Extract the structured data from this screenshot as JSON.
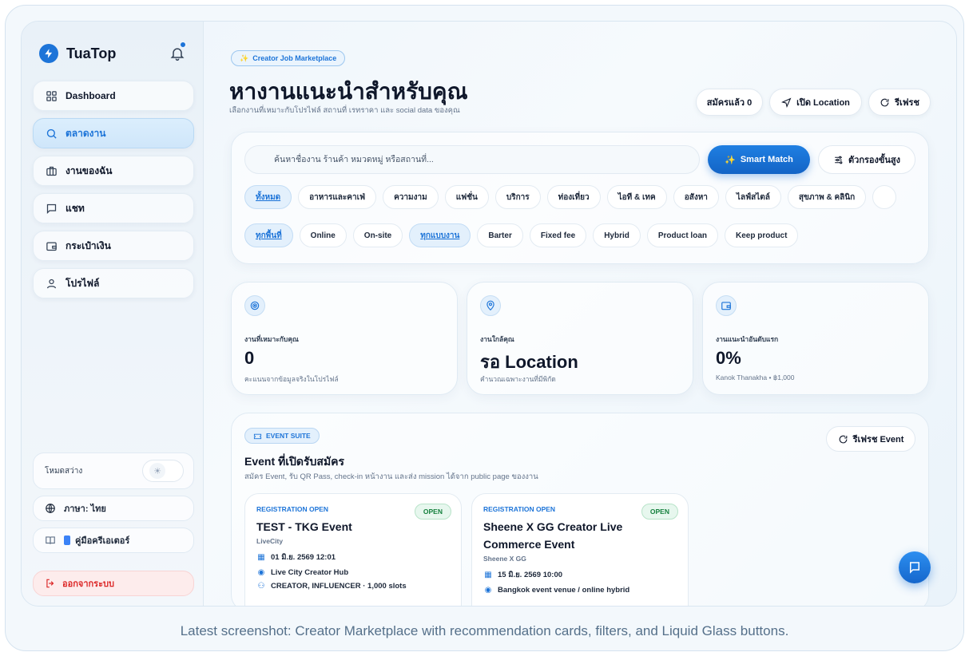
{
  "app": {
    "name": "TuaTop"
  },
  "sidebar": {
    "items": [
      {
        "label": "Dashboard",
        "icon": "grid-icon"
      },
      {
        "label": "ตลาดงาน",
        "icon": "search-icon"
      },
      {
        "label": "งานของฉัน",
        "icon": "briefcase-icon"
      },
      {
        "label": "แชท",
        "icon": "chat-icon"
      },
      {
        "label": "กระเป๋าเงิน",
        "icon": "wallet-icon"
      },
      {
        "label": "โปรไฟล์",
        "icon": "user-icon"
      }
    ],
    "theme_label": "โหมดสว่าง",
    "language_label": "ภาษา: ไทย",
    "guide_label": "คู่มือครีเอเตอร์",
    "logout_label": "ออกจากระบบ"
  },
  "header": {
    "tag": "Creator Job Marketplace",
    "title": "หางานแนะนำสำหรับคุณ",
    "subtitle": "เลือกงานที่เหมาะกับโปรไฟล์ สถานที่ เรทราคา และ social data ของคุณ",
    "applied_label": "สมัครแล้ว 0",
    "location_label": "เปิด Location",
    "refresh_label": "รีเฟรช"
  },
  "search": {
    "placeholder": "ค้นหาชื่องาน ร้านค้า หมวดหมู่ หรือสถานที่...",
    "smart_match_label": "Smart Match",
    "advanced_label": "ตัวกรองขั้นสูง"
  },
  "categories": [
    "ทั้งหมด",
    "อาหารและคาเฟ่",
    "ความงาม",
    "แฟชั่น",
    "บริการ",
    "ท่องเที่ยว",
    "ไอที & เทค",
    "อสังหา",
    "ไลฟ์สไตล์",
    "สุขภาพ & คลินิก",
    ""
  ],
  "filters": [
    "ทุกพื้นที่",
    "Online",
    "On-site",
    "ทุกแบบงาน",
    "Barter",
    "Fixed fee",
    "Hybrid",
    "Product loan",
    "Keep product"
  ],
  "stats": [
    {
      "label": "งานที่เหมาะกับคุณ",
      "value": "0",
      "note": "คะแนนจากข้อมูลจริงในโปรไฟล์",
      "icon": "target-icon"
    },
    {
      "label": "งานใกล้คุณ",
      "value": "รอ Location",
      "note": "คำนวณเฉพาะงานที่มีพิกัด",
      "icon": "pin-icon"
    },
    {
      "label": "งานแนะนำอันดับแรก",
      "value": "0%",
      "note": "Kanok Thanakha • ฿1,000",
      "icon": "wallet-icon"
    }
  ],
  "events": {
    "tag": "EVENT SUITE",
    "title": "Event ที่เปิดรับสมัคร",
    "subtitle": "สมัคร Event, รับ QR Pass, check-in หน้างาน และส่ง mission ได้จาก public page ของงาน",
    "refresh_label": "รีเฟรช Event",
    "cards": [
      {
        "status": "REGISTRATION OPEN",
        "badge": "OPEN",
        "name": "TEST - TKG Event",
        "org": "LiveCity",
        "date": "01 มิ.ย. 2569 12:01",
        "venue": "Live City Creator Hub",
        "slots": "CREATOR, INFLUENCER · 1,000 slots"
      },
      {
        "status": "REGISTRATION OPEN",
        "badge": "OPEN",
        "name": "Sheene X GG Creator Live Commerce Event",
        "org": "Sheene X GG",
        "date": "15 มิ.ย. 2569 10:00",
        "venue": "Bangkok event venue / online hybrid"
      }
    ]
  },
  "caption": "Latest screenshot: Creator Marketplace with recommendation cards, filters, and Liquid Glass buttons.",
  "colors": {
    "accent": "#1d74d8",
    "success": "#15803d",
    "danger": "#dc2626"
  }
}
